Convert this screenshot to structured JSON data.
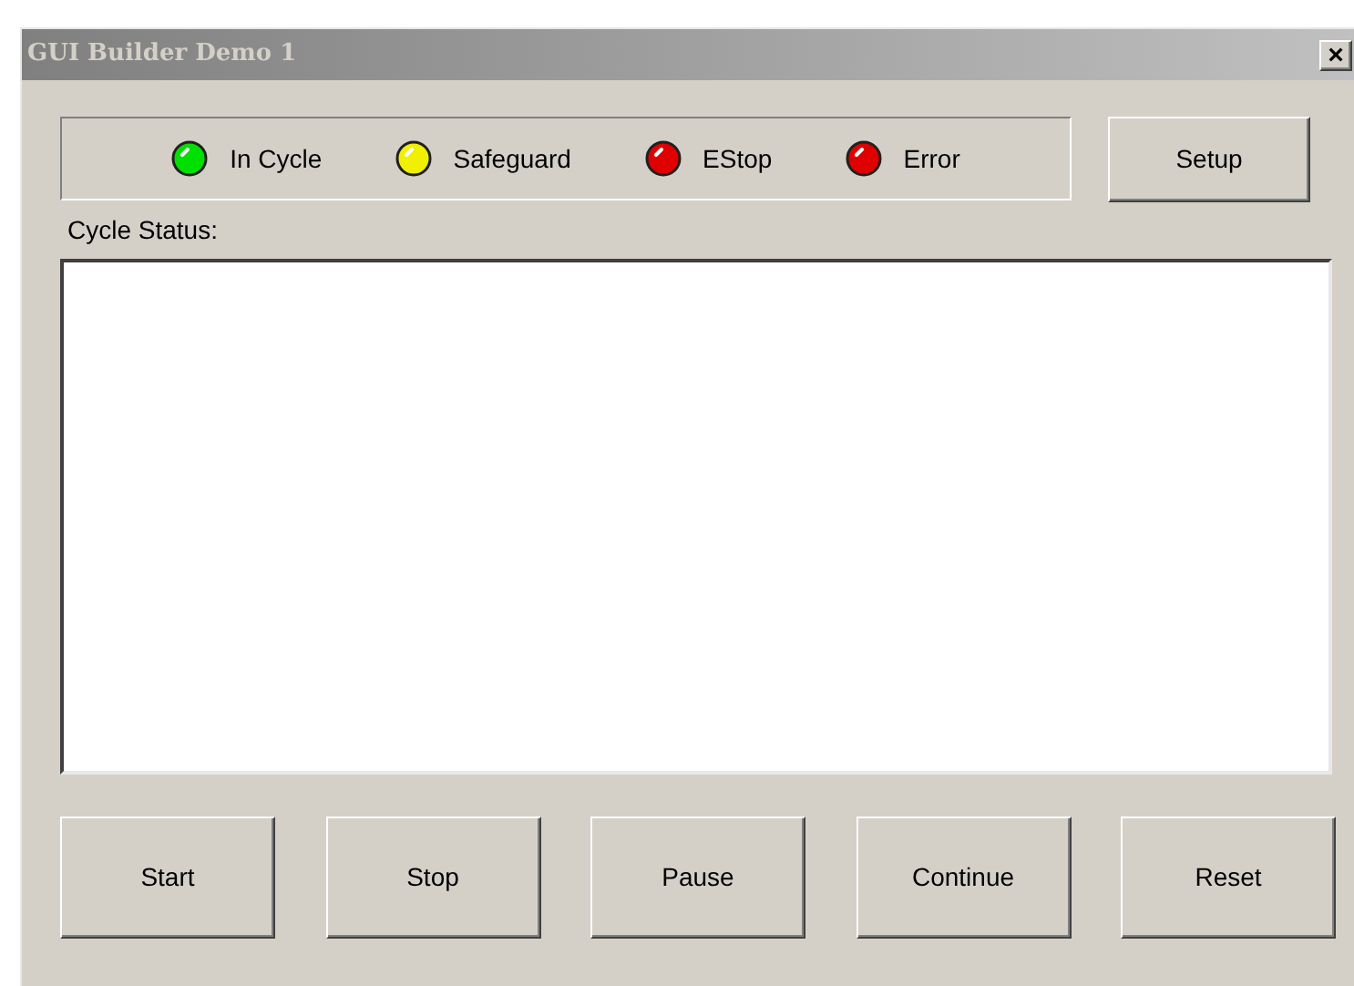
{
  "window": {
    "title": "GUI Builder Demo 1",
    "close": "×"
  },
  "indicators": [
    {
      "label": "In Cycle",
      "color": "#00e000"
    },
    {
      "label": "Safeguard",
      "color": "#f0f000"
    },
    {
      "label": "EStop",
      "color": "#e00000"
    },
    {
      "label": "Error",
      "color": "#e00000"
    }
  ],
  "setup_button": "Setup",
  "status": {
    "label": "Cycle Status:"
  },
  "buttons": [
    "Start",
    "Stop",
    "Pause",
    "Continue",
    "Reset"
  ]
}
